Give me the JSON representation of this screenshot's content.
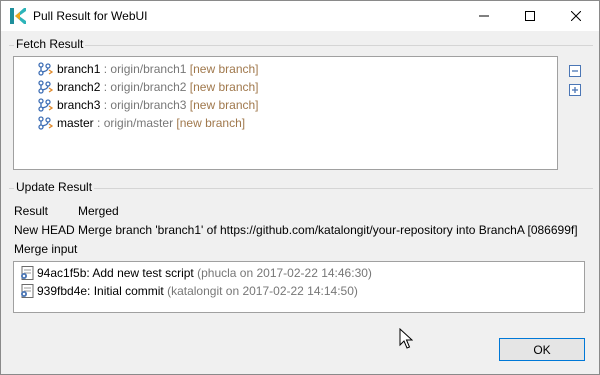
{
  "window": {
    "title": "Pull Result for WebUI",
    "minimize_icon": "minimize-icon",
    "maximize_icon": "maximize-icon",
    "close_icon": "close-icon"
  },
  "fetch_result": {
    "label": "Fetch Result",
    "branches": [
      {
        "name": "branch1",
        "separator": " : ",
        "remote": "origin/branch1",
        "tag": "[new branch]"
      },
      {
        "name": "branch2",
        "separator": " : ",
        "remote": "origin/branch2",
        "tag": "[new branch]"
      },
      {
        "name": "branch3",
        "separator": " : ",
        "remote": "origin/branch3",
        "tag": "[new branch]"
      },
      {
        "name": "master",
        "separator": " : ",
        "remote": "origin/master",
        "tag": "[new branch]"
      }
    ],
    "collapse_all_icon": "collapse-all-icon",
    "expand_all_icon": "expand-all-icon"
  },
  "update_result": {
    "label": "Update Result",
    "result_label": "Result",
    "result_value": "Merged",
    "new_head_label": "New HEAD",
    "new_head_value": "Merge branch 'branch1' of https://github.com/katalongit/your-repository into BranchA [086699f]",
    "merge_input_label": "Merge input",
    "commits": [
      {
        "id_msg": "94ac1f5b: Add new test script",
        "meta": "(phucla on 2017-02-22 14:46:30)"
      },
      {
        "id_msg": "939fbd4e: Initial commit",
        "meta": "(katalongit on 2017-02-22 14:14:50)"
      }
    ]
  },
  "buttons": {
    "ok": "OK"
  },
  "colors": {
    "accent": "#0078d7",
    "tag": "#a0784c",
    "muted": "#777777"
  }
}
